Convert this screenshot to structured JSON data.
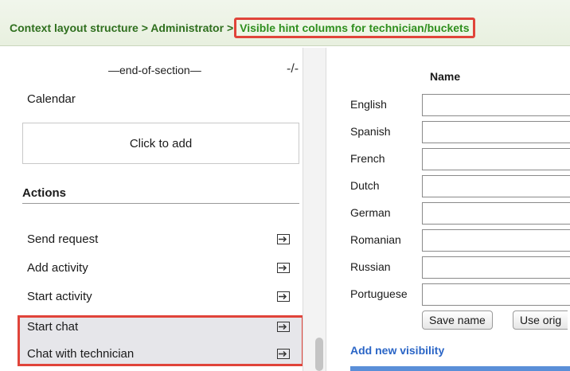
{
  "breadcrumb": {
    "items": [
      "Context layout structure",
      "Administrator"
    ],
    "separator": ">",
    "current": "Visible hint columns for technician/buckets"
  },
  "left": {
    "end_section_label": "—end-of-section—",
    "calendar_label": "Calendar",
    "add_box_label": "Click to add",
    "actions_header": "Actions",
    "actions": [
      {
        "label": "Send request",
        "icon": "add-to-right-icon"
      },
      {
        "label": "Add activity",
        "icon": "add-to-right-icon"
      },
      {
        "label": "Start activity",
        "icon": "add-to-right-icon"
      },
      {
        "label": "Start chat",
        "icon": "add-to-right-icon"
      },
      {
        "label": "Chat with technician",
        "icon": "add-to-right-icon"
      }
    ]
  },
  "right": {
    "name_header": "Name",
    "languages": [
      {
        "label": "English",
        "value": ""
      },
      {
        "label": "Spanish",
        "value": ""
      },
      {
        "label": "French",
        "value": ""
      },
      {
        "label": "Dutch",
        "value": ""
      },
      {
        "label": "German",
        "value": ""
      },
      {
        "label": "Romanian",
        "value": ""
      },
      {
        "label": "Russian",
        "value": ""
      },
      {
        "label": "Portuguese",
        "value": ""
      }
    ],
    "save_name_label": "Save name",
    "use_original_label": "Use orig",
    "add_new_visibility_label": "Add new visibility"
  },
  "colors": {
    "breadcrumb_text": "#2f6f1e",
    "highlight": "#e0443a",
    "link": "#2a65c6"
  }
}
